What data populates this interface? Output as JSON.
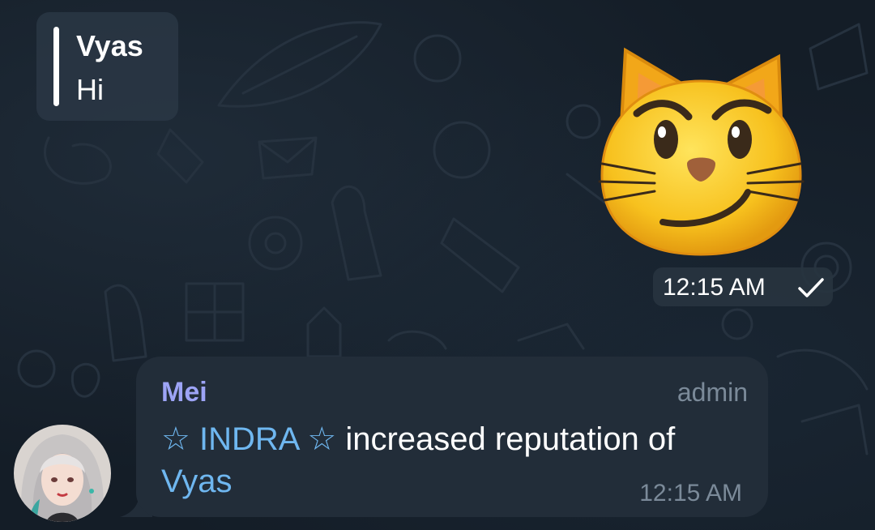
{
  "reply": {
    "author": "Vyas",
    "text": "Hi"
  },
  "sticker": {
    "icon": "smirking-cat-icon",
    "time": "12:15 AM",
    "status_icon": "check-icon"
  },
  "message": {
    "sender": "Mei",
    "role": "admin",
    "star": "☆",
    "sender_title": "INDRA",
    "text": "increased reputation of",
    "mention": "Vyas",
    "time": "12:15 AM"
  },
  "colors": {
    "background": "#141d27",
    "bubble": "#222d39",
    "sender_name": "#9da4f6",
    "link": "#6fb7f0",
    "meta": "#7b8a99"
  }
}
